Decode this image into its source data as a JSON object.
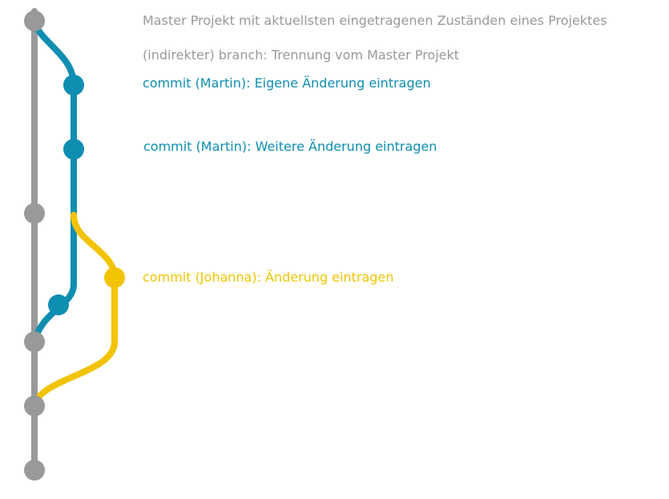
{
  "colors": {
    "master": "#999999",
    "martin": "#0e8eb1",
    "johanna": "#f2c300"
  },
  "labels": {
    "master": "Master Projekt mit aktuellsten eingetragenen Zuständen eines Projektes",
    "branch": "(indirekter) branch: Trennung vom Master Projekt",
    "commit_martin_1": "commit (Martin): Eigene Änderung eintragen",
    "commit_martin_2": "commit (Martin): Weitere Änderung eintragen",
    "commit_johanna": "commit (Johanna): Änderung eintragen"
  }
}
